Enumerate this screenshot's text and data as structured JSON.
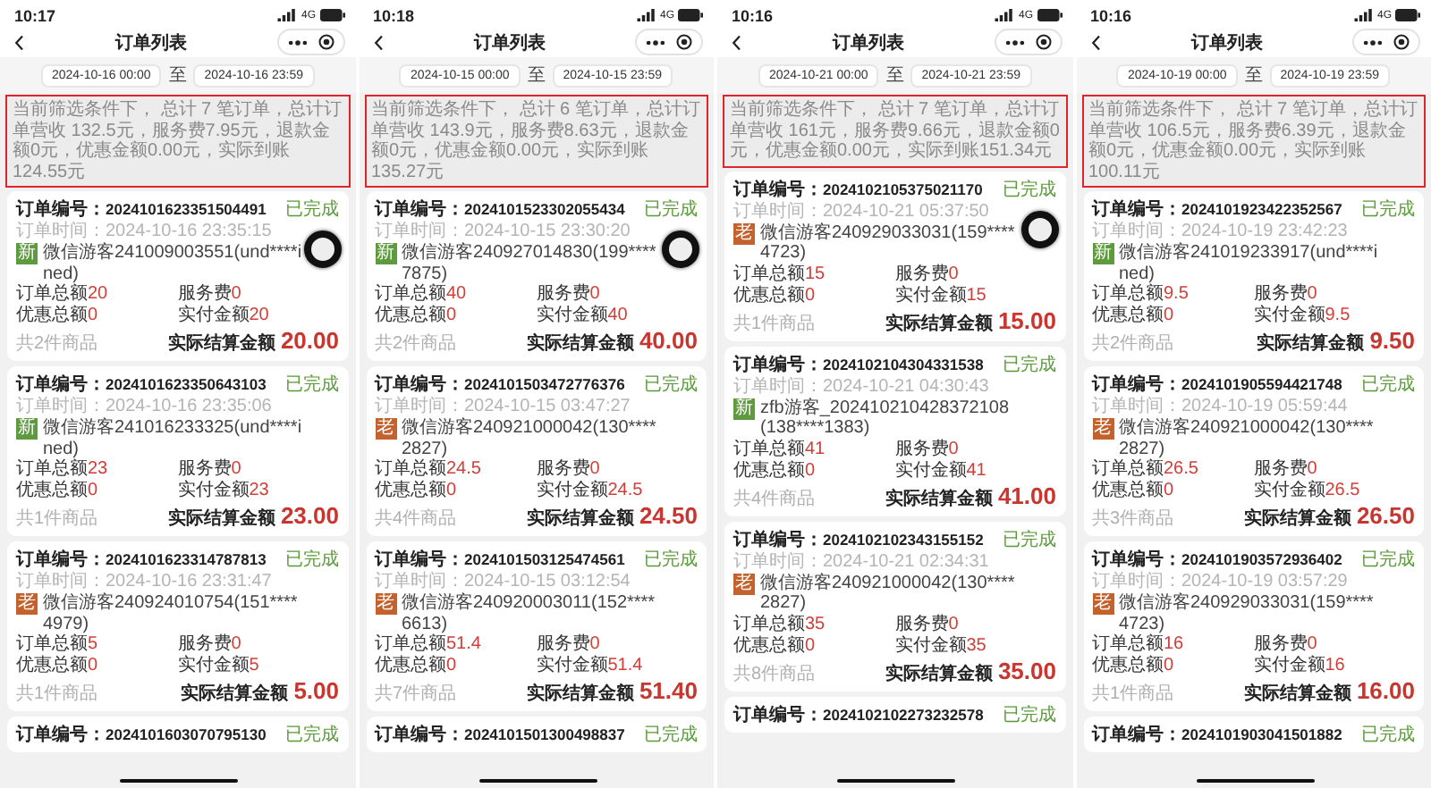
{
  "panels": [
    {
      "status_time": "10:17",
      "network": "4G",
      "title": "订单列表",
      "date_start": "2024-10-16 00:00",
      "date_sep": "至",
      "date_end": "2024-10-16 23:59",
      "summary": "当前筛选条件下， 总计 7 笔订单，总计订单营收 132.5元，服务费7.95元，退款金额0元，优惠金额0.00元，实际到账124.55元",
      "floating_button": true,
      "orders": [
        {
          "order_no_label": "订单编号：",
          "order_no": "2024101623351504491",
          "status": "已完成",
          "time": "订单时间：2024-10-16 23:35:15",
          "tag": {
            "text": "新",
            "color": "#5e9a3e"
          },
          "customer": "微信游客241009003551(und****ined)",
          "amounts": [
            {
              "label": "订单总额",
              "value": "20"
            },
            {
              "label": "服务费",
              "value": "0"
            },
            {
              "label": "优惠总额",
              "value": "0"
            },
            {
              "label": "实付金额",
              "value": "20"
            }
          ],
          "item_count": "共2件商品",
          "settle_label": "实际结算金额",
          "settle_amount": "20.00"
        },
        {
          "order_no_label": "订单编号：",
          "order_no": "2024101623350643103",
          "status": "已完成",
          "time": "订单时间：2024-10-16 23:35:06",
          "tag": {
            "text": "新",
            "color": "#5e9a3e"
          },
          "customer": "微信游客241016233325(und****ined)",
          "amounts": [
            {
              "label": "订单总额",
              "value": "23"
            },
            {
              "label": "服务费",
              "value": "0"
            },
            {
              "label": "优惠总额",
              "value": "0"
            },
            {
              "label": "实付金额",
              "value": "23"
            }
          ],
          "item_count": "共1件商品",
          "settle_label": "实际结算金额",
          "settle_amount": "23.00"
        },
        {
          "order_no_label": "订单编号：",
          "order_no": "2024101623314787813",
          "status": "已完成",
          "time": "订单时间：2024-10-16 23:31:47",
          "tag": {
            "text": "老",
            "color": "#c4622d"
          },
          "customer": "微信游客240924010754(151****4979)",
          "amounts": [
            {
              "label": "订单总额",
              "value": "5"
            },
            {
              "label": "服务费",
              "value": "0"
            },
            {
              "label": "优惠总额",
              "value": "0"
            },
            {
              "label": "实付金额",
              "value": "5"
            }
          ],
          "item_count": "共1件商品",
          "settle_label": "实际结算金额",
          "settle_amount": "5.00"
        },
        {
          "order_no_label": "订单编号：",
          "order_no": "2024101603070795130",
          "status": "已完成"
        }
      ]
    },
    {
      "status_time": "10:18",
      "network": "4G",
      "title": "订单列表",
      "date_start": "2024-10-15 00:00",
      "date_sep": "至",
      "date_end": "2024-10-15 23:59",
      "summary": "当前筛选条件下， 总计 6 笔订单，总计订单营收 143.9元，服务费8.63元，退款金额0元，优惠金额0.00元，实际到账135.27元",
      "floating_button": true,
      "orders": [
        {
          "order_no_label": "订单编号：",
          "order_no": "2024101523302055434",
          "status": "已完成",
          "time": "订单时间：2024-10-15 23:30:20",
          "tag": {
            "text": "新",
            "color": "#5e9a3e"
          },
          "customer": "微信游客240927014830(199****7875)",
          "amounts": [
            {
              "label": "订单总额",
              "value": "40"
            },
            {
              "label": "服务费",
              "value": "0"
            },
            {
              "label": "优惠总额",
              "value": "0"
            },
            {
              "label": "实付金额",
              "value": "40"
            }
          ],
          "item_count": "共2件商品",
          "settle_label": "实际结算金额",
          "settle_amount": "40.00"
        },
        {
          "order_no_label": "订单编号：",
          "order_no": "2024101503472776376",
          "status": "已完成",
          "time": "订单时间：2024-10-15 03:47:27",
          "tag": {
            "text": "老",
            "color": "#c4622d"
          },
          "customer": "微信游客240921000042(130****2827)",
          "amounts": [
            {
              "label": "订单总额",
              "value": "24.5"
            },
            {
              "label": "服务费",
              "value": "0"
            },
            {
              "label": "优惠总额",
              "value": "0"
            },
            {
              "label": "实付金额",
              "value": "24.5"
            }
          ],
          "item_count": "共4件商品",
          "settle_label": "实际结算金额",
          "settle_amount": "24.50"
        },
        {
          "order_no_label": "订单编号：",
          "order_no": "2024101503125474561",
          "status": "已完成",
          "time": "订单时间：2024-10-15 03:12:54",
          "tag": {
            "text": "老",
            "color": "#c4622d"
          },
          "customer": "微信游客240920003011(152****6613)",
          "amounts": [
            {
              "label": "订单总额",
              "value": "51.4"
            },
            {
              "label": "服务费",
              "value": "0"
            },
            {
              "label": "优惠总额",
              "value": "0"
            },
            {
              "label": "实付金额",
              "value": "51.4"
            }
          ],
          "item_count": "共7件商品",
          "settle_label": "实际结算金额",
          "settle_amount": "51.40"
        },
        {
          "order_no_label": "订单编号：",
          "order_no": "2024101501300498837",
          "status": "已完成"
        }
      ]
    },
    {
      "status_time": "10:16",
      "network": "4G",
      "title": "订单列表",
      "date_start": "2024-10-21 00:00",
      "date_sep": "至",
      "date_end": "2024-10-21 23:59",
      "summary": "当前筛选条件下， 总计 7 笔订单，总计订单营收 161元，服务费9.66元，退款金额0元，优惠金额0.00元，实际到账151.34元",
      "floating_button": true,
      "orders": [
        {
          "order_no_label": "订单编号：",
          "order_no": "2024102105375021170",
          "status": "已完成",
          "time": "订单时间：2024-10-21 05:37:50",
          "tag": {
            "text": "老",
            "color": "#c4622d"
          },
          "customer": "微信游客240929033031(159****4723)",
          "amounts": [
            {
              "label": "订单总额",
              "value": "15"
            },
            {
              "label": "服务费",
              "value": "0"
            },
            {
              "label": "优惠总额",
              "value": "0"
            },
            {
              "label": "实付金额",
              "value": "15"
            }
          ],
          "item_count": "共1件商品",
          "settle_label": "实际结算金额",
          "settle_amount": "15.00"
        },
        {
          "order_no_label": "订单编号：",
          "order_no": "2024102104304331538",
          "status": "已完成",
          "time": "订单时间：2024-10-21 04:30:43",
          "tag": {
            "text": "新",
            "color": "#5e9a3e"
          },
          "customer": "zfb游客_202410210428372108(138****1383)",
          "amounts": [
            {
              "label": "订单总额",
              "value": "41"
            },
            {
              "label": "服务费",
              "value": "0"
            },
            {
              "label": "优惠总额",
              "value": "0"
            },
            {
              "label": "实付金额",
              "value": "41"
            }
          ],
          "item_count": "共4件商品",
          "settle_label": "实际结算金额",
          "settle_amount": "41.00"
        },
        {
          "order_no_label": "订单编号：",
          "order_no": "2024102102343155152",
          "status": "已完成",
          "time": "订单时间：2024-10-21 02:34:31",
          "tag": {
            "text": "老",
            "color": "#c4622d"
          },
          "customer": "微信游客240921000042(130****2827)",
          "amounts": [
            {
              "label": "订单总额",
              "value": "35"
            },
            {
              "label": "服务费",
              "value": "0"
            },
            {
              "label": "优惠总额",
              "value": "0"
            },
            {
              "label": "实付金额",
              "value": "35"
            }
          ],
          "item_count": "共8件商品",
          "settle_label": "实际结算金额",
          "settle_amount": "35.00"
        },
        {
          "order_no_label": "订单编号：",
          "order_no": "2024102102273232578",
          "status": "已完成"
        }
      ]
    },
    {
      "status_time": "10:16",
      "network": "4G",
      "title": "订单列表",
      "date_start": "2024-10-19 00:00",
      "date_sep": "至",
      "date_end": "2024-10-19 23:59",
      "summary": "当前筛选条件下， 总计 7 笔订单，总计订单营收 106.5元，服务费6.39元，退款金额0元，优惠金额0.00元，实际到账100.11元",
      "floating_button": false,
      "orders": [
        {
          "order_no_label": "订单编号：",
          "order_no": "2024101923422352567",
          "status": "已完成",
          "time": "订单时间：2024-10-19 23:42:23",
          "tag": {
            "text": "新",
            "color": "#5e9a3e"
          },
          "customer": "微信游客241019233917(und****ined)",
          "amounts": [
            {
              "label": "订单总额",
              "value": "9.5"
            },
            {
              "label": "服务费",
              "value": "0"
            },
            {
              "label": "优惠总额",
              "value": "0"
            },
            {
              "label": "实付金额",
              "value": "9.5"
            }
          ],
          "item_count": "共2件商品",
          "settle_label": "实际结算金额",
          "settle_amount": "9.50"
        },
        {
          "order_no_label": "订单编号：",
          "order_no": "2024101905594421748",
          "status": "已完成",
          "time": "订单时间：2024-10-19 05:59:44",
          "tag": {
            "text": "老",
            "color": "#c4622d"
          },
          "customer": "微信游客240921000042(130****2827)",
          "amounts": [
            {
              "label": "订单总额",
              "value": "26.5"
            },
            {
              "label": "服务费",
              "value": "0"
            },
            {
              "label": "优惠总额",
              "value": "0"
            },
            {
              "label": "实付金额",
              "value": "26.5"
            }
          ],
          "item_count": "共3件商品",
          "settle_label": "实际结算金额",
          "settle_amount": "26.50"
        },
        {
          "order_no_label": "订单编号：",
          "order_no": "2024101903572936402",
          "status": "已完成",
          "time": "订单时间：2024-10-19 03:57:29",
          "tag": {
            "text": "老",
            "color": "#c4622d"
          },
          "customer": "微信游客240929033031(159****4723)",
          "amounts": [
            {
              "label": "订单总额",
              "value": "16"
            },
            {
              "label": "服务费",
              "value": "0"
            },
            {
              "label": "优惠总额",
              "value": "0"
            },
            {
              "label": "实付金额",
              "value": "16"
            }
          ],
          "item_count": "共1件商品",
          "settle_label": "实际结算金额",
          "settle_amount": "16.00"
        },
        {
          "order_no_label": "订单编号：",
          "order_no": "2024101903041501882",
          "status": "已完成"
        }
      ]
    }
  ]
}
